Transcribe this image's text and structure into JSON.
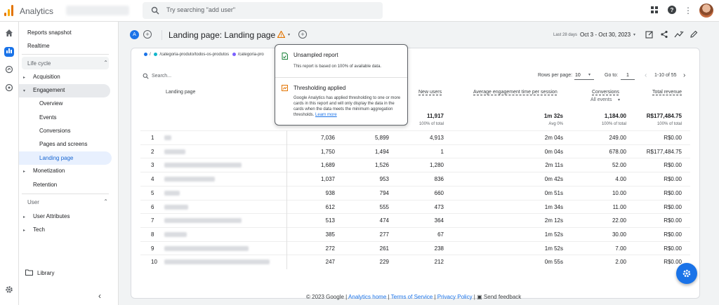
{
  "header": {
    "app_name": "Analytics",
    "search_placeholder": "Try searching \"add user\""
  },
  "nav": {
    "reports_snapshot": "Reports snapshot",
    "realtime": "Realtime",
    "lifecycle": "Life cycle",
    "acquisition": "Acquisition",
    "engagement": "Engagement",
    "overview": "Overview",
    "events": "Events",
    "conversions": "Conversions",
    "pages_and_screens": "Pages and screens",
    "landing_page": "Landing page",
    "monetization": "Monetization",
    "retention": "Retention",
    "user": "User",
    "user_attributes": "User Attributes",
    "tech": "Tech",
    "library": "Library"
  },
  "report": {
    "avatar_letter": "A",
    "title": "Landing page: Landing page",
    "date_label": "Last 28 days",
    "date_range": "Oct 3 - Oct 30, 2023",
    "legend": [
      "/",
      "/categoria-produto/todos-os-produtos",
      "/categoria-pro"
    ],
    "legend_colors": [
      "#1a73e8",
      "#12b5cb",
      "#7b61ff"
    ]
  },
  "table": {
    "search_placeholder": "Search...",
    "rows_per_page_label": "Rows per page:",
    "rows_per_page": "10",
    "goto_label": "Go to:",
    "goto_value": "1",
    "range": "1-10 of 55",
    "col_landing": "Landing page",
    "col_new_users": "New users",
    "col_avg_engagement": "Average engagement time per session",
    "col_conversions": "Conversions",
    "conversions_filter": "All events",
    "col_revenue": "Total revenue",
    "totals": {
      "new_users": "11,917",
      "avg_engagement": "1m 32s",
      "conversions": "1,184.00",
      "revenue": "R$177,484.75"
    },
    "totals_sub": {
      "new_users": "100% of total",
      "avg_engagement": "Avg 0%",
      "conversions": "100% of total",
      "revenue": "100% of total"
    },
    "rows": [
      {
        "idx": "1",
        "a": "7,036",
        "b": "5,899",
        "new": "4,913",
        "avg": "2m 04s",
        "conv": "249.00",
        "rev": "R$0.00"
      },
      {
        "idx": "2",
        "a": "1,750",
        "b": "1,494",
        "new": "1",
        "avg": "0m 04s",
        "conv": "678.00",
        "rev": "R$177,484.75"
      },
      {
        "idx": "3",
        "a": "1,689",
        "b": "1,526",
        "new": "1,280",
        "avg": "2m 11s",
        "conv": "52.00",
        "rev": "R$0.00"
      },
      {
        "idx": "4",
        "a": "1,037",
        "b": "953",
        "new": "836",
        "avg": "0m 42s",
        "conv": "4.00",
        "rev": "R$0.00"
      },
      {
        "idx": "5",
        "a": "938",
        "b": "794",
        "new": "660",
        "avg": "0m 51s",
        "conv": "10.00",
        "rev": "R$0.00"
      },
      {
        "idx": "6",
        "a": "612",
        "b": "555",
        "new": "473",
        "avg": "1m 34s",
        "conv": "11.00",
        "rev": "R$0.00"
      },
      {
        "idx": "7",
        "a": "513",
        "b": "474",
        "new": "364",
        "avg": "2m 12s",
        "conv": "22.00",
        "rev": "R$0.00"
      },
      {
        "idx": "8",
        "a": "385",
        "b": "277",
        "new": "67",
        "avg": "1m 52s",
        "conv": "30.00",
        "rev": "R$0.00"
      },
      {
        "idx": "9",
        "a": "272",
        "b": "261",
        "new": "238",
        "avg": "1m 52s",
        "conv": "7.00",
        "rev": "R$0.00"
      },
      {
        "idx": "10",
        "a": "247",
        "b": "229",
        "new": "212",
        "avg": "0m 55s",
        "conv": "2.00",
        "rev": "R$0.00"
      }
    ]
  },
  "popup": {
    "unsampled_title": "Unsampled report",
    "unsampled_text": "This report is based on 100% of available data.",
    "threshold_title": "Thresholding applied",
    "threshold_text": "Google Analytics has applied thresholding to one or more cards in this report and will only display the data in the cards when the data meets the minimum aggregation thresholds.",
    "learn_more": "Learn more"
  },
  "footer": {
    "copyright": "© 2023 Google",
    "home": "Analytics home",
    "terms": "Terms of Service",
    "privacy": "Privacy Policy",
    "feedback": "Send feedback"
  }
}
